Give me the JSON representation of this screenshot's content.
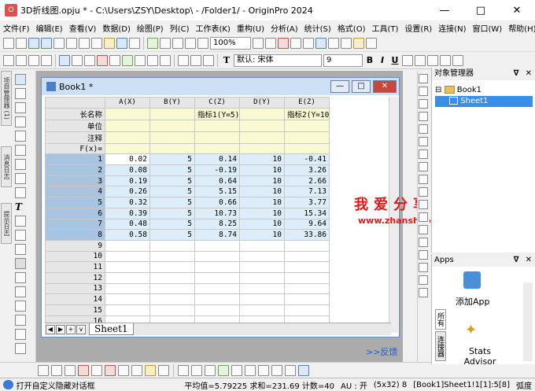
{
  "window": {
    "title": "3D折线图.opju * - C:\\Users\\ZSY\\Desktop\\ - /Folder1/ - OriginPro 2024"
  },
  "menu": [
    "文件(F)",
    "编辑(E)",
    "查看(V)",
    "数据(D)",
    "绘图(P)",
    "列(C)",
    "工作表(K)",
    "重构(U)",
    "分析(A)",
    "统计(S)",
    "格式(O)",
    "工具(T)",
    "设置(R)",
    "连接(N)",
    "窗口(W)",
    "帮助(H)"
  ],
  "toolbar": {
    "zoom": "100%",
    "font": "默认: 宋体",
    "font_size": "9",
    "bold": "B",
    "italic": "I",
    "underline": "U"
  },
  "left_tabs": [
    "项目管理器 (1)",
    "消息日志",
    "提示日志"
  ],
  "workbook": {
    "title": "Book1 *",
    "columns": [
      "A(X)",
      "B(Y)",
      "C(Z)",
      "D(Y)",
      "E(Z)"
    ],
    "meta": [
      {
        "label": "长名称",
        "cells": [
          "",
          "",
          "指标1(Y=5)",
          "",
          "指标2(Y=10"
        ]
      },
      {
        "label": "单位",
        "cells": [
          "",
          "",
          "",
          "",
          ""
        ]
      },
      {
        "label": "注释",
        "cells": [
          "",
          "",
          "",
          "",
          ""
        ]
      },
      {
        "label": "F(x)=",
        "cells": [
          "",
          "",
          "",
          "",
          ""
        ]
      }
    ],
    "rows": [
      {
        "n": "1",
        "cells": [
          "0.02",
          "5",
          "0.14",
          "10",
          "-0.41"
        ]
      },
      {
        "n": "2",
        "cells": [
          "0.08",
          "5",
          "-0.19",
          "10",
          "3.26"
        ]
      },
      {
        "n": "3",
        "cells": [
          "0.19",
          "5",
          "0.64",
          "10",
          "2.66"
        ]
      },
      {
        "n": "4",
        "cells": [
          "0.26",
          "5",
          "5.15",
          "10",
          "7.13"
        ]
      },
      {
        "n": "5",
        "cells": [
          "0.32",
          "5",
          "0.66",
          "10",
          "3.77"
        ]
      },
      {
        "n": "6",
        "cells": [
          "0.39",
          "5",
          "10.73",
          "10",
          "15.34"
        ]
      },
      {
        "n": "7",
        "cells": [
          "0.48",
          "5",
          "8.25",
          "10",
          "9.64"
        ]
      },
      {
        "n": "8",
        "cells": [
          "0.58",
          "5",
          "8.74",
          "10",
          "33.86"
        ]
      }
    ],
    "empty_rows": [
      "9",
      "10",
      "11",
      "12",
      "13",
      "14",
      "15",
      "16"
    ],
    "sheet_tab": "Sheet1"
  },
  "feedback": ">>反馈",
  "watermark": {
    "text": "我爱分享网",
    "url": "www.zhanshaoyi.com"
  },
  "object_manager": {
    "title": "对象管理器",
    "items": [
      "Book1",
      "Sheet1"
    ]
  },
  "apps": {
    "title": "Apps",
    "tabs": [
      "所有",
      "连接器"
    ],
    "items": [
      "添加App",
      "Stats Advisor"
    ]
  },
  "status": {
    "left": "打开自定义隐藏对话框",
    "stats": "平均值=5.79225 求和=231.69 计数=40",
    "au": "AU : 开",
    "size": "(5x32) 8",
    "ref": "[Book1]Sheet1!1[1]:5[8]",
    "unit": "弧度"
  }
}
